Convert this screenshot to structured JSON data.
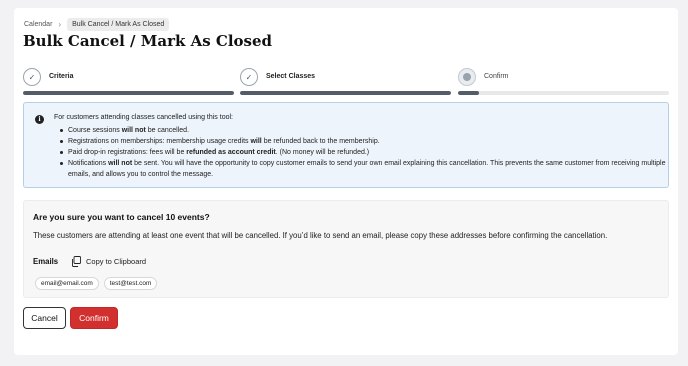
{
  "breadcrumb": {
    "parent": "Calendar",
    "current": "Bulk Cancel / Mark As Closed"
  },
  "page_title": "Bulk Cancel / Mark As Closed",
  "steps": [
    {
      "label": "Criteria",
      "status": "complete",
      "progress": 1.0,
      "icon": "check-icon"
    },
    {
      "label": "Select Classes",
      "status": "complete",
      "progress": 1.0,
      "icon": "check-icon"
    },
    {
      "label": "Confirm",
      "status": "current",
      "progress": 0.1,
      "icon": "dot-icon"
    }
  ],
  "info": {
    "icon": "info-icon",
    "intro": "For customers attending classes cancelled using this tool:",
    "items": [
      {
        "a": "Course sessions ",
        "b": "will not",
        "c": " be cancelled."
      },
      {
        "a": "Registrations on memberships: membership usage credits ",
        "b": "will",
        "c": " be refunded back to the membership."
      },
      {
        "a": "Paid drop-in registrations: fees will be ",
        "b": "refunded as account credit",
        "c": ". (No money will be refunded.)"
      },
      {
        "a": "Notifications ",
        "b": "will not",
        "c": " be sent. You will have the opportunity to copy customer emails to send your own email explaining this cancellation. This prevents the same customer from receiving multiple emails, and allows you to control the message."
      }
    ]
  },
  "confirm": {
    "heading": "Are you sure you want to cancel 10 events?",
    "description": "These customers are attending at least one event that will be cancelled. If you’d like to send an email, please copy these addresses before confirming the cancellation.",
    "emails_label": "Emails",
    "copy_label": "Copy to Clipboard",
    "emails": [
      "email@email.com",
      "test@test.com"
    ]
  },
  "actions": {
    "cancel_label": "Cancel",
    "confirm_label": "Confirm"
  },
  "colors": {
    "confirm_button": "#d22f2f",
    "progress_fill": "#555c69",
    "info_background": "#eef4fb",
    "info_border": "#b5cfe6"
  }
}
